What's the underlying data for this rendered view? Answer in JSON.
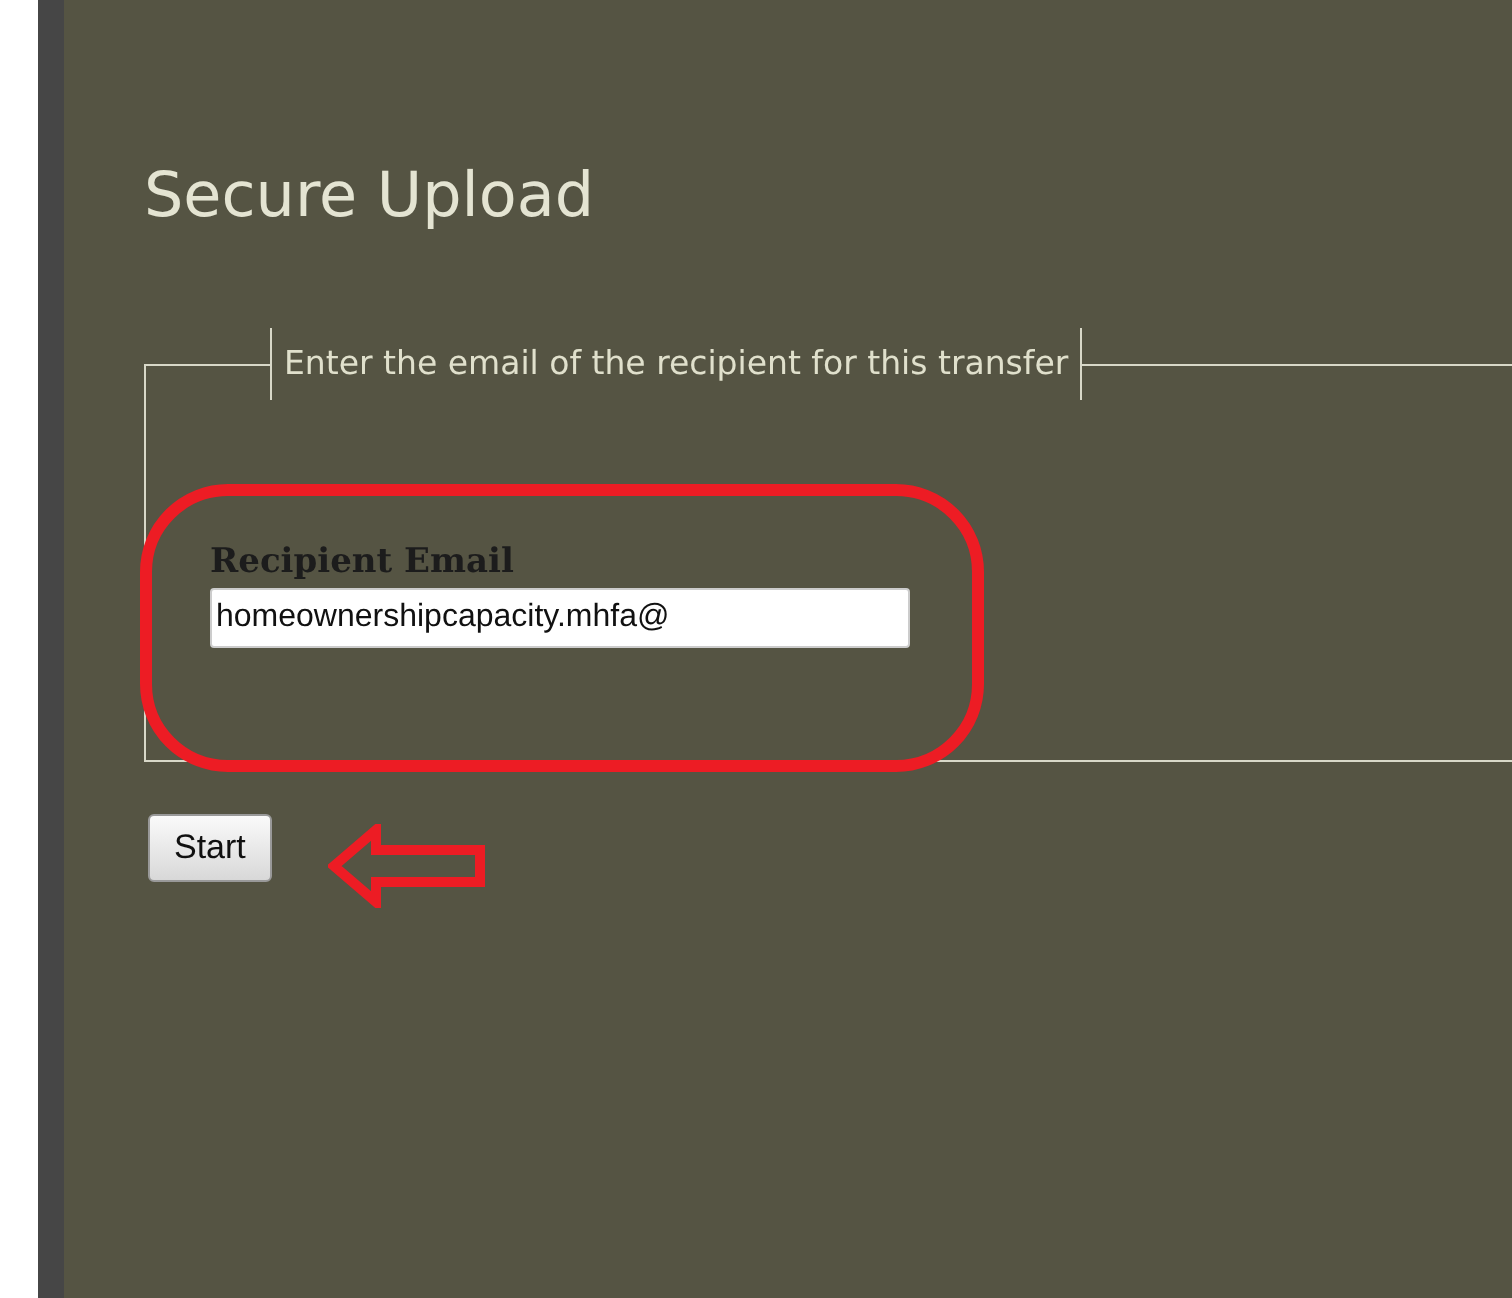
{
  "page_title": "Secure Upload",
  "form": {
    "legend": "Enter the email of the recipient for this transfer",
    "field_label": "Recipient Email",
    "email_value": "homeownershipcapacity.mhfa@"
  },
  "buttons": [
    {
      "label": "Start"
    }
  ]
}
